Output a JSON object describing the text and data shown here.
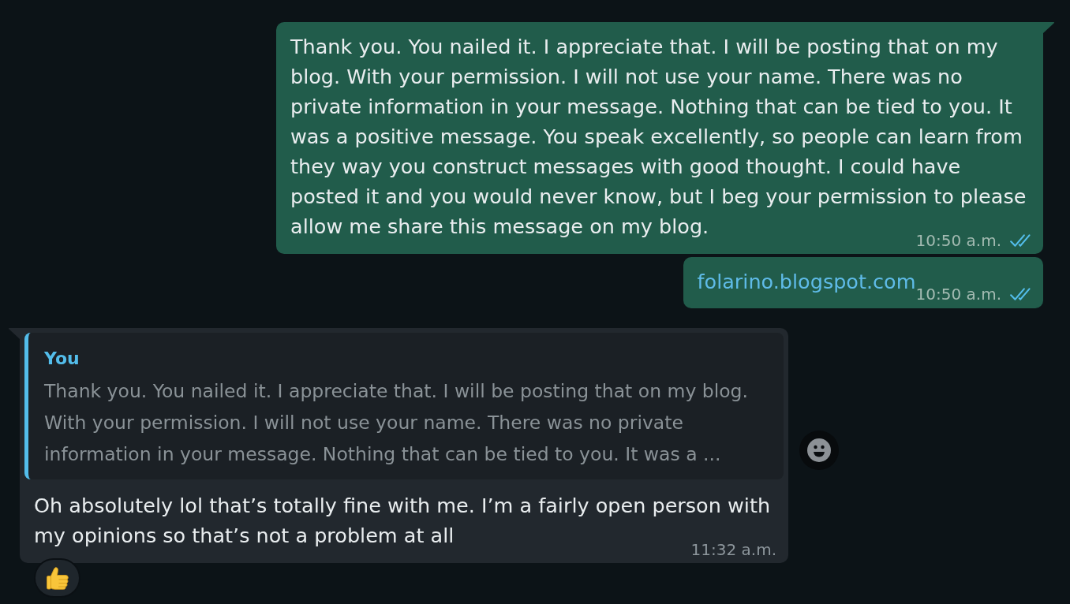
{
  "messages": [
    {
      "outgoing": true,
      "kind": "text",
      "tail": true,
      "hovered": false,
      "text": "Thank you. You nailed it. I appreciate that. I will be posting that on my blog. With your permission. I will not use your name. There was no private information in your message. Nothing that can be tied to you. It was a positive message. You speak excellently, so people can learn from they way you construct messages with good thought. I could have posted it and you would never know, but I beg your permission to please allow me share this message on my blog.",
      "time": "10:50 a.m.",
      "read": true
    },
    {
      "outgoing": true,
      "kind": "link",
      "tail": false,
      "hovered": false,
      "text": "folarino.blogspot.com",
      "time": "10:50 a.m.",
      "read": true
    },
    {
      "outgoing": false,
      "kind": "text",
      "tail": true,
      "hovered": true,
      "quote": {
        "author": "You",
        "text": "Thank you. You nailed it. I appreciate that. I will be posting that on my blog. With your permission. I will not use your name. There was no private information in your message. Nothing that can be tied to you. It was a ..."
      },
      "text": "Oh absolutely lol that’s totally fine with me. I’m a fairly open person with my opinions so that’s not a problem at all",
      "time": "11:32 a.m.",
      "reactions": [
        {
          "kind": "thumbs_up"
        }
      ]
    }
  ]
}
